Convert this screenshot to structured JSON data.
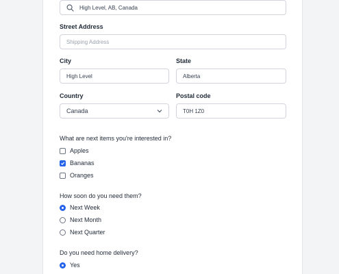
{
  "address_search": {
    "value": "High Level, AB, Canada"
  },
  "street_address": {
    "label": "Street Address",
    "placeholder": "Shipping Address"
  },
  "city": {
    "label": "City",
    "value": "High Level"
  },
  "state": {
    "label": "State",
    "value": "Alberta"
  },
  "country": {
    "label": "Country",
    "value": "Canada"
  },
  "postal_code": {
    "label": "Postal code",
    "value": "T0H 1Z0"
  },
  "interests": {
    "question": "What are next items you're interested in?",
    "options": [
      {
        "label": "Apples",
        "checked": false
      },
      {
        "label": "Bananas",
        "checked": true
      },
      {
        "label": "Oranges",
        "checked": false
      }
    ]
  },
  "timing": {
    "question": "How soon do you need them?",
    "options": [
      {
        "label": "Next Week",
        "selected": true
      },
      {
        "label": "Next Month",
        "selected": false
      },
      {
        "label": "Next Quarter",
        "selected": false
      }
    ]
  },
  "delivery": {
    "question": "Do you need home delivery?",
    "options": [
      {
        "label": "Yes",
        "selected": true
      }
    ]
  },
  "colors": {
    "accent": "#2563eb",
    "border": "#d1d5db"
  }
}
